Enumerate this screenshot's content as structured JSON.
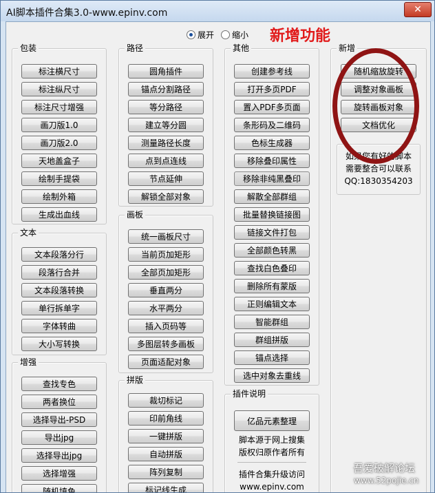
{
  "window": {
    "title": "AI脚本插件合集3.0-www.epinv.com",
    "close_label": "✕"
  },
  "view_mode": {
    "expand_label": "展开",
    "collapse_label": "缩小",
    "selected": "展开"
  },
  "annotation": {
    "new_features_label": "新增功能",
    "circle_color": "#8f1414",
    "label_color": "#e11b1b"
  },
  "groups": {
    "packaging": {
      "label": "包装",
      "buttons": [
        "标注横尺寸",
        "标注纵尺寸",
        "标注尺寸增强",
        "画刀版1.0",
        "画刀版2.0",
        "天地盖盒子",
        "绘制手提袋",
        "绘制外箱",
        "生成出血线"
      ]
    },
    "text": {
      "label": "文本",
      "buttons": [
        "文本段落分行",
        "段落行合并",
        "文本段落转换",
        "单行拆单字",
        "字体转曲",
        "大小写转换"
      ]
    },
    "enhance": {
      "label": "增强",
      "buttons": [
        "查找专色",
        "两者换位",
        "选择导出-PSD",
        "导出jpg",
        "选择导出jpg",
        "选择增强",
        "随机填色"
      ]
    },
    "path": {
      "label": "路径",
      "buttons": [
        "圆角插件",
        "锚点分割路径",
        "等分路径",
        "建立等分圆",
        "测量路径长度",
        "点到点连线",
        "节点延伸",
        "解锁全部对象"
      ]
    },
    "artboard": {
      "label": "画板",
      "buttons": [
        "统一画板尺寸",
        "当前页加矩形",
        "全部页加矩形",
        "垂直两分",
        "水平两分",
        "插入页码等",
        "多图层转多画板",
        "页面适配对象"
      ]
    },
    "imposition": {
      "label": "拼版",
      "buttons": [
        "裁切标记",
        "印前角线",
        "一键拼版",
        "自动拼版",
        "阵列复制",
        "标记线生成"
      ]
    },
    "other": {
      "label": "其他",
      "buttons": [
        "创建参考线",
        "打开多页PDF",
        "置入PDF多页面",
        "条形码及二维码",
        "色标生成器",
        "移除叠印属性",
        "移除非纯黑叠印",
        "解散全部群组",
        "批量替换链接图",
        "链接文件打包",
        "全部颜色转黑",
        "查找白色叠印",
        "删除所有蒙版",
        "正则编辑文本",
        "智能群组",
        "群组拼版",
        "锚点选择",
        "选中对象去重线"
      ]
    },
    "plugin_info": {
      "label": "插件说明",
      "button": "亿品元素整理",
      "line1": "脚本源于网上搜集",
      "line2": "版权归原作者所有",
      "line3": "插件合集升级访问",
      "line4": "www.epinv.com"
    },
    "new": {
      "label": "新增",
      "buttons": [
        "随机缩放旋转",
        "调整对象画板",
        "旋转画板对象",
        "文档优化"
      ]
    },
    "contact": {
      "line1": "如果您有好的脚本",
      "line2": "需要整合可以联系",
      "line3": "QQ:1830354203"
    }
  },
  "watermark": {
    "line1": "吾爱破解论坛",
    "line2": "www.52pojie.cn"
  }
}
